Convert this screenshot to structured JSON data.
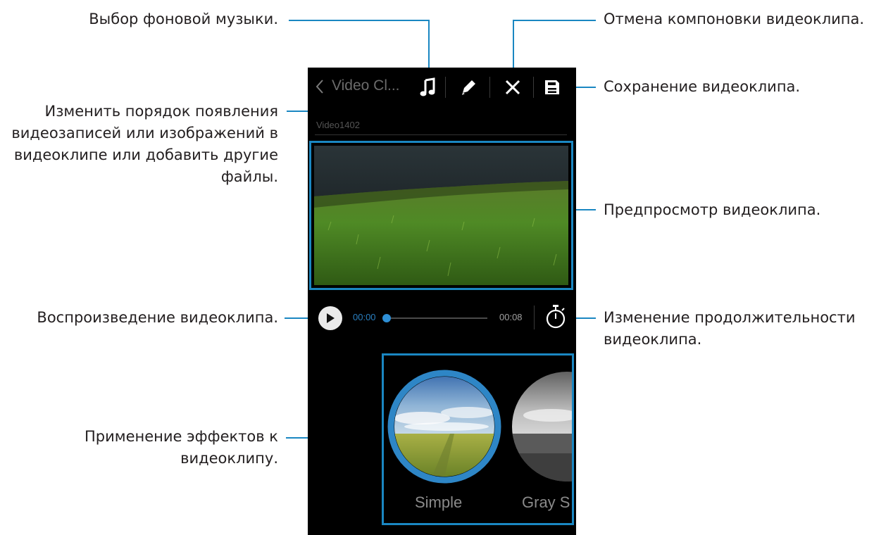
{
  "callouts": {
    "background_music": "Выбор фоновой музыки.",
    "edit_order_line1": "Изменить порядок появления",
    "edit_order_line2": "видеозаписей или изображений в",
    "edit_order_line3": "видеоклипе или добавить другие",
    "edit_order_line4": "файлы.",
    "playback": "Воспроизведение видеоклипа.",
    "effects_line1": "Применение эффектов к",
    "effects_line2": "видеоклипу.",
    "cancel": "Отмена компоновки видеоклипа.",
    "save": "Сохранение видеоклипа.",
    "preview": "Предпросмотр видеоклипа.",
    "duration_line1": "Изменение продолжительности",
    "duration_line2": "видеоклипа."
  },
  "app": {
    "title": "Video Cl...",
    "subtitle": "Video1402",
    "toolbar_icons": [
      "back-chevron-icon",
      "music-note-icon",
      "pencil-icon",
      "close-icon",
      "save-icon"
    ]
  },
  "player": {
    "current_time": "00:00",
    "total_time": "00:08",
    "progress": 0.0,
    "icons": [
      "play-icon",
      "timer-icon"
    ]
  },
  "effects": [
    {
      "label": "Simple",
      "selected": true
    },
    {
      "label": "Gray S"
    }
  ],
  "colors": {
    "accent": "#1a87c2",
    "screen_bg": "#000000",
    "time_current": "#2a7fc0"
  }
}
